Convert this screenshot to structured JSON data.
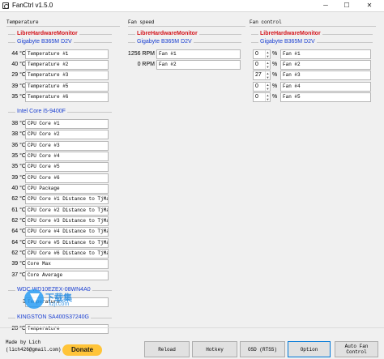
{
  "window": {
    "title": "FanCtrl v1.5.0",
    "minimize": "─",
    "maximize": "☐",
    "close": "✕"
  },
  "temperature": {
    "header": "Temperature",
    "groups": [
      {
        "type": "provider",
        "label": "LibreHardwareMonitor"
      },
      {
        "type": "device",
        "label": "Gigabyte B365M D2V"
      },
      {
        "type": "device",
        "label": "Intel Core i5-9400F"
      },
      {
        "type": "device",
        "label": "WDC WD10EZEX-08WN4A0"
      },
      {
        "type": "device",
        "label": "KINGSTON SA400S37240G"
      }
    ],
    "board_sensors": [
      {
        "value": "44 °C",
        "name": "Temperature #1"
      },
      {
        "value": "40 °C",
        "name": "Temperature #2"
      },
      {
        "value": "29 °C",
        "name": "Temperature #3"
      },
      {
        "value": "39 °C",
        "name": "Temperature #5"
      },
      {
        "value": "35 °C",
        "name": "Temperature #6"
      }
    ],
    "cpu_sensors": [
      {
        "value": "38 °C",
        "name": "CPU Core #1"
      },
      {
        "value": "38 °C",
        "name": "CPU Core #2"
      },
      {
        "value": "36 °C",
        "name": "CPU Core #3"
      },
      {
        "value": "35 °C",
        "name": "CPU Core #4"
      },
      {
        "value": "35 °C",
        "name": "CPU Core #5"
      },
      {
        "value": "39 °C",
        "name": "CPU Core #6"
      },
      {
        "value": "40 °C",
        "name": "CPU Package"
      },
      {
        "value": "62 °C",
        "name": "CPU Core #1 Distance to TjMax"
      },
      {
        "value": "61 °C",
        "name": "CPU Core #2 Distance to TjMax"
      },
      {
        "value": "62 °C",
        "name": "CPU Core #3 Distance to TjMax"
      },
      {
        "value": "64 °C",
        "name": "CPU Core #4 Distance to TjMax"
      },
      {
        "value": "64 °C",
        "name": "CPU Core #5 Distance to TjMax"
      },
      {
        "value": "62 °C",
        "name": "CPU Core #6 Distance to TjMax"
      },
      {
        "value": "39 °C",
        "name": "Core Max"
      },
      {
        "value": "37 °C",
        "name": "Core Average"
      }
    ],
    "hdd_sensors": [
      {
        "value": "3",
        "name": "Temperature"
      }
    ],
    "ssd_sensors": [
      {
        "value": "28 °C",
        "name": "Temperature"
      }
    ]
  },
  "fan_speed": {
    "header": "Fan speed",
    "groups": [
      {
        "type": "provider",
        "label": "LibreHardwareMonitor"
      },
      {
        "type": "device",
        "label": "Gigabyte B365M D2V"
      }
    ],
    "fans": [
      {
        "value": "1256 RPM",
        "name": "Fan #1"
      },
      {
        "value": "0 RPM",
        "name": "Fan #2"
      }
    ]
  },
  "fan_control": {
    "header": "Fan control",
    "groups": [
      {
        "type": "provider",
        "label": "LibreHardwareMonitor"
      },
      {
        "type": "device",
        "label": "Gigabyte B365M D2V"
      }
    ],
    "controls": [
      {
        "value": "0",
        "unit": "%",
        "name": "Fan #1"
      },
      {
        "value": "0",
        "unit": "%",
        "name": "Fan #2"
      },
      {
        "value": "27",
        "unit": "%",
        "name": "Fan #3"
      },
      {
        "value": "0",
        "unit": "%",
        "name": "Fan #4"
      },
      {
        "value": "0",
        "unit": "%",
        "name": "Fan #5"
      }
    ]
  },
  "footer": {
    "made_by_line1": "Made by Lich",
    "made_by_line2": "(lich426@gmail.com)",
    "donate_label": "Donate",
    "reload_label": "Reload",
    "hotkey_label": "Hotkey",
    "osd_label": "OSD (RTSS)",
    "option_label": "Option",
    "auto_fan_label_line1": "Auto Fan",
    "auto_fan_label_line2": "Control"
  },
  "watermark": {
    "text1": "下载集",
    "text2": "xzji.com"
  },
  "colors": {
    "provider": "#d4161d",
    "device": "#1a3fd1",
    "donate": "#ffc439",
    "focus": "#0078d7"
  }
}
